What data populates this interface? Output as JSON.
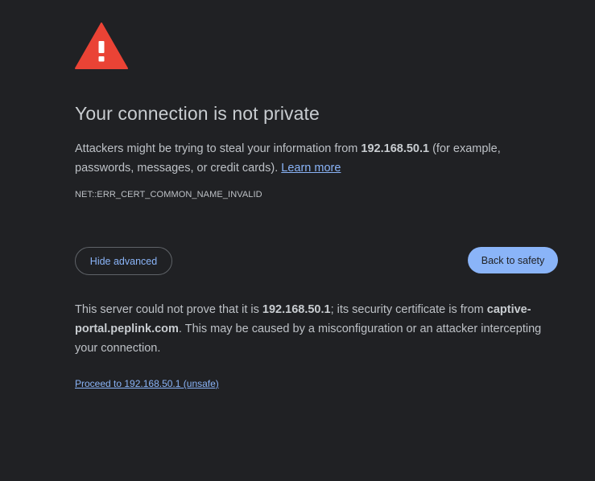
{
  "page": {
    "title": "Your connection is not private",
    "icon": "warning-triangle-icon",
    "icon_color": "#ea4335",
    "background_color": "#202124",
    "accent_color": "#8ab4f8"
  },
  "intro": {
    "text_before_host": "Attackers might be trying to steal your information from ",
    "host": "192.168.50.1",
    "text_after_host": " (for example, passwords, messages, or credit cards). ",
    "learn_more_label": "Learn more"
  },
  "error_code": "NET::ERR_CERT_COMMON_NAME_INVALID",
  "buttons": {
    "hide_advanced_label": "Hide advanced",
    "back_to_safety_label": "Back to safety"
  },
  "details": {
    "text_before_host": "This server could not prove that it is ",
    "host": "192.168.50.1",
    "text_middle": "; its security certificate is from ",
    "cert_domain": "captive-portal.peplink.com",
    "text_after": ". This may be caused by a misconfiguration or an attacker intercepting your connection."
  },
  "proceed_link_label": "Proceed to 192.168.50.1 (unsafe)"
}
